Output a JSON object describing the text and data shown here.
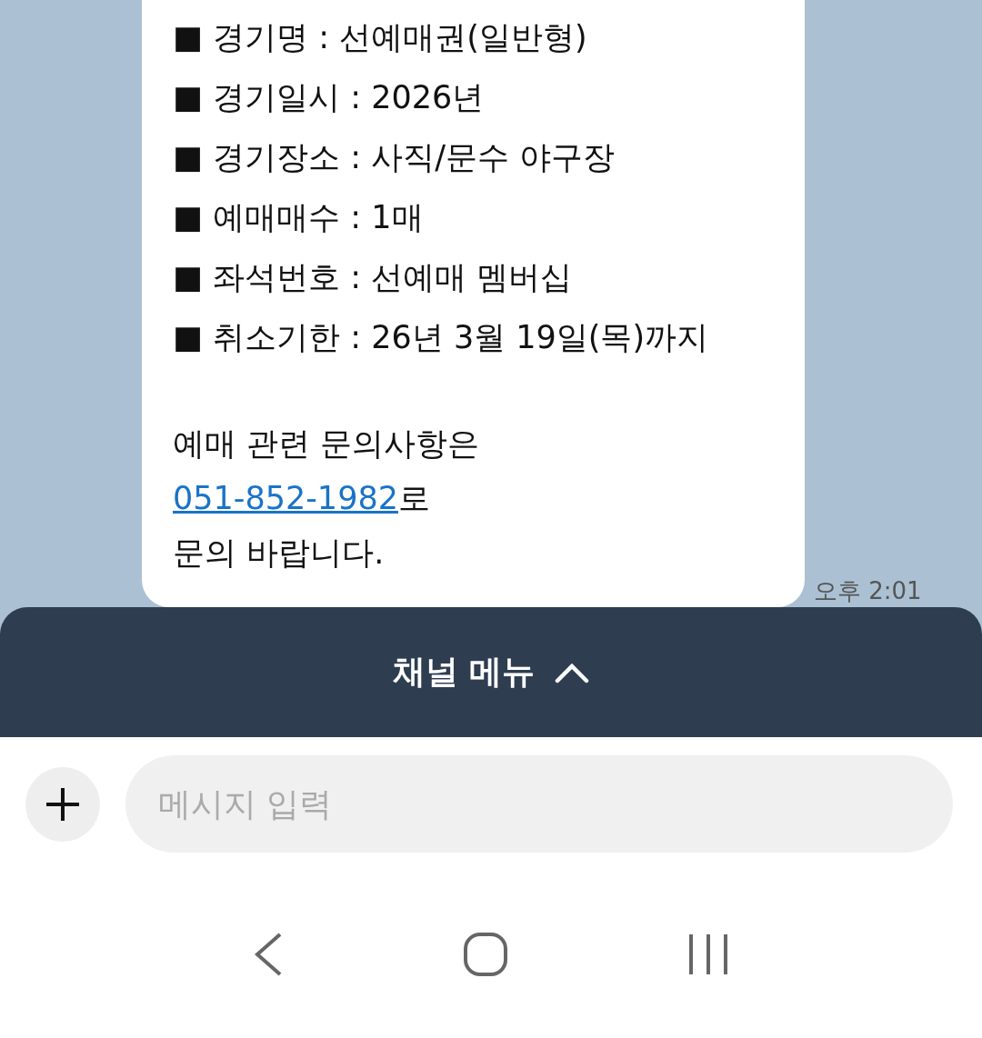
{
  "message": {
    "lines": [
      "■ 경기명 : 선예매권(일반형)",
      "■ 경기일시 : 2026년",
      "■ 경기장소 : 사직/문수 야구장",
      "■ 예매매수 : 1매",
      "■ 좌석번호 : 선예매 멤버십",
      "■ 취소기한 : 26년 3월 19일(목)까지"
    ],
    "contact": {
      "before": "예매 관련 문의사항은",
      "link": "051-852-1982",
      "after_link": "로",
      "closing": "문의 바랍니다."
    },
    "time": "오후 2:01"
  },
  "channel_menu": {
    "label": "채널 메뉴"
  },
  "composer": {
    "placeholder": "메시지 입력"
  }
}
